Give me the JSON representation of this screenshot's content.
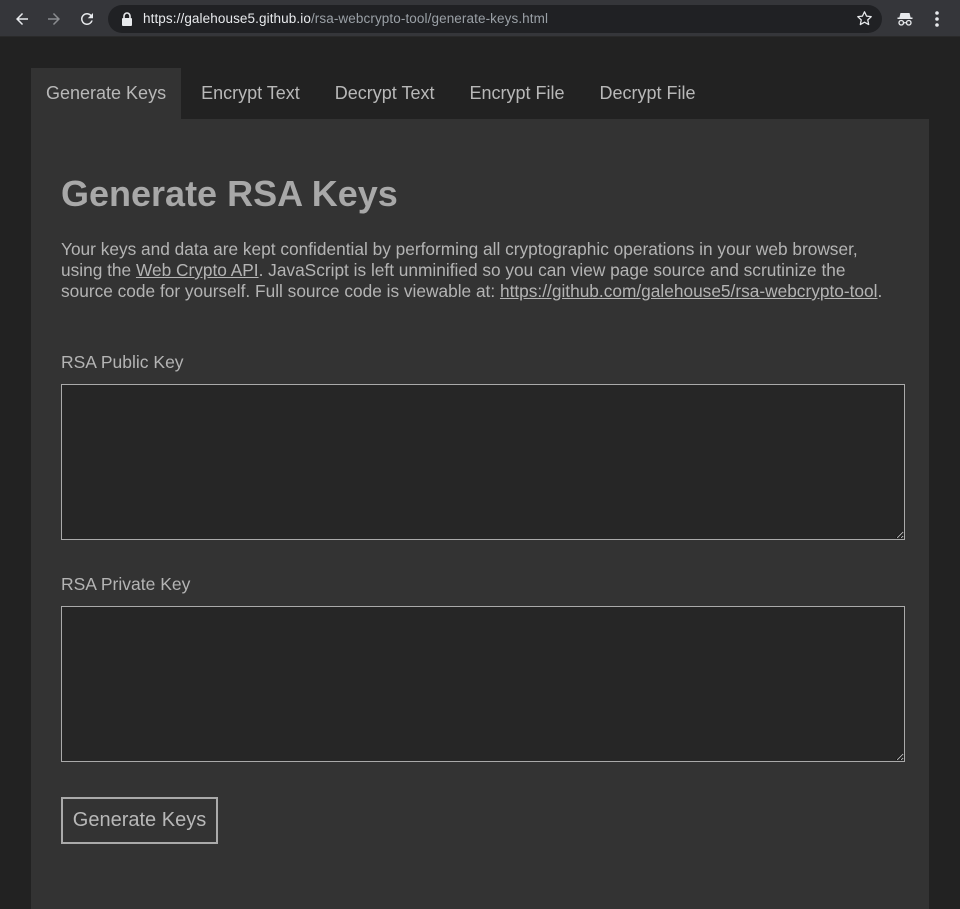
{
  "browser": {
    "url_host": "https://galehouse5.github.io",
    "url_path": "/rsa-webcrypto-tool/generate-keys.html"
  },
  "tabs": [
    {
      "label": "Generate Keys",
      "active": true
    },
    {
      "label": "Encrypt Text",
      "active": false
    },
    {
      "label": "Decrypt Text",
      "active": false
    },
    {
      "label": "Encrypt File",
      "active": false
    },
    {
      "label": "Decrypt File",
      "active": false
    }
  ],
  "main": {
    "title": "Generate RSA Keys",
    "intro": {
      "part1": "Your keys and data are kept confidential by performing all cryptographic operations in your web browser, using the ",
      "link1": "Web Crypto API",
      "part2": ". JavaScript is left unminified so you can view page source and scrutinize the source code for yourself. Full source code is viewable at: ",
      "link2": "https://github.com/galehouse5/rsa-webcrypto-tool",
      "part3": "."
    },
    "public_key_label": "RSA Public Key",
    "public_key_value": "",
    "private_key_label": "RSA Private Key",
    "private_key_value": "",
    "generate_button": "Generate Keys"
  },
  "icons": {
    "back": "arrow-left-icon",
    "forward": "arrow-right-icon",
    "reload": "reload-icon",
    "secure": "lock-icon",
    "bookmark": "star-icon",
    "extension": "incognito-icon",
    "menu": "kebab-menu-icon"
  }
}
